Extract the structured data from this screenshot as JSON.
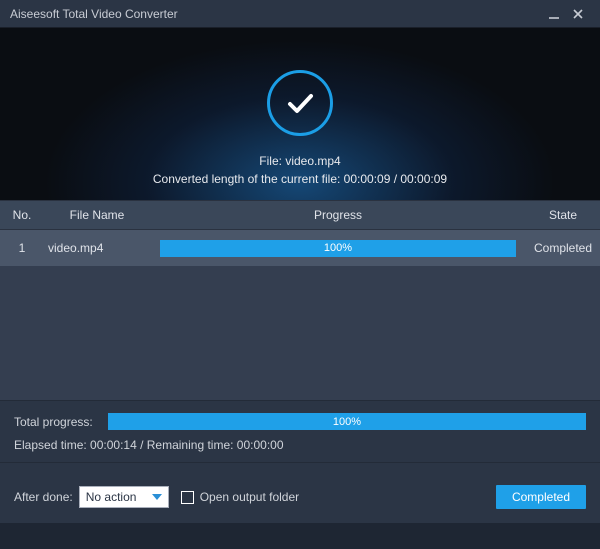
{
  "window": {
    "title": "Aiseesoft Total Video Converter"
  },
  "hero": {
    "file_prefix": "File: ",
    "file_name": "video.mp4",
    "conv_line": "Converted length of the current file: 00:00:09 / 00:00:09"
  },
  "table": {
    "headers": {
      "no": "No.",
      "name": "File Name",
      "progress": "Progress",
      "state": "State"
    },
    "rows": [
      {
        "no": "1",
        "name": "video.mp4",
        "percent": "100%",
        "percent_width": "100%",
        "state": "Completed"
      }
    ]
  },
  "total": {
    "label": "Total progress:",
    "percent": "100%",
    "percent_width": "100%",
    "timing": "Elapsed time: 00:00:14 / Remaining time: 00:00:00"
  },
  "footer": {
    "after_done_label": "After done:",
    "select_value": "No action",
    "open_folder_label": "Open output folder",
    "button": "Completed"
  }
}
